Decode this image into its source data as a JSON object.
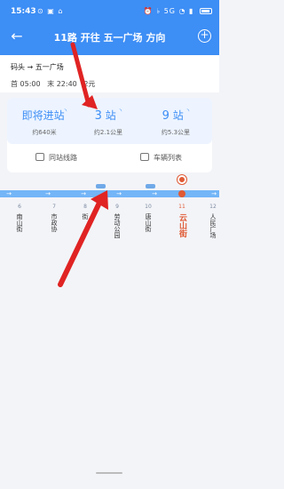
{
  "status_bar": {
    "time": "15:43",
    "left_icons": "⊙ ▣ ⌂",
    "right_icons": "⏰ ♭ 5G ◔ ▮"
  },
  "nav": {
    "title": "11路 开往 五一广场 方向",
    "back_icon": "back-arrow-icon",
    "add_icon": "plus-circle-icon"
  },
  "info": {
    "route": "码头 → 五一广场",
    "first_label": "首 05:00",
    "last_label": "末 22:40",
    "fare": "2元"
  },
  "arrival": {
    "stats": [
      {
        "main": "即将进站",
        "number": "",
        "unit": "",
        "sub": "约640米"
      },
      {
        "main": "",
        "number": "3",
        "unit": "站",
        "sub": "约2.1公里"
      },
      {
        "main": "",
        "number": "9",
        "unit": "站",
        "sub": "约5.3公里"
      }
    ],
    "same_stop_routes": "同站线路",
    "vehicle_list": "车辆列表"
  },
  "stops": [
    {
      "no": "6",
      "name": "南山街"
    },
    {
      "no": "7",
      "name": "市政协"
    },
    {
      "no": "8",
      "name": "街"
    },
    {
      "no": "9",
      "name": "劳动公园"
    },
    {
      "no": "10",
      "name": "唐山街"
    },
    {
      "no": "11",
      "name": "云山街"
    },
    {
      "no": "12",
      "name": "人民广场"
    }
  ],
  "colors": {
    "primary": "#3d8ef5",
    "route_line": "#73b5f7",
    "current_stop": "#e05a35",
    "annotation": "#e02323"
  }
}
